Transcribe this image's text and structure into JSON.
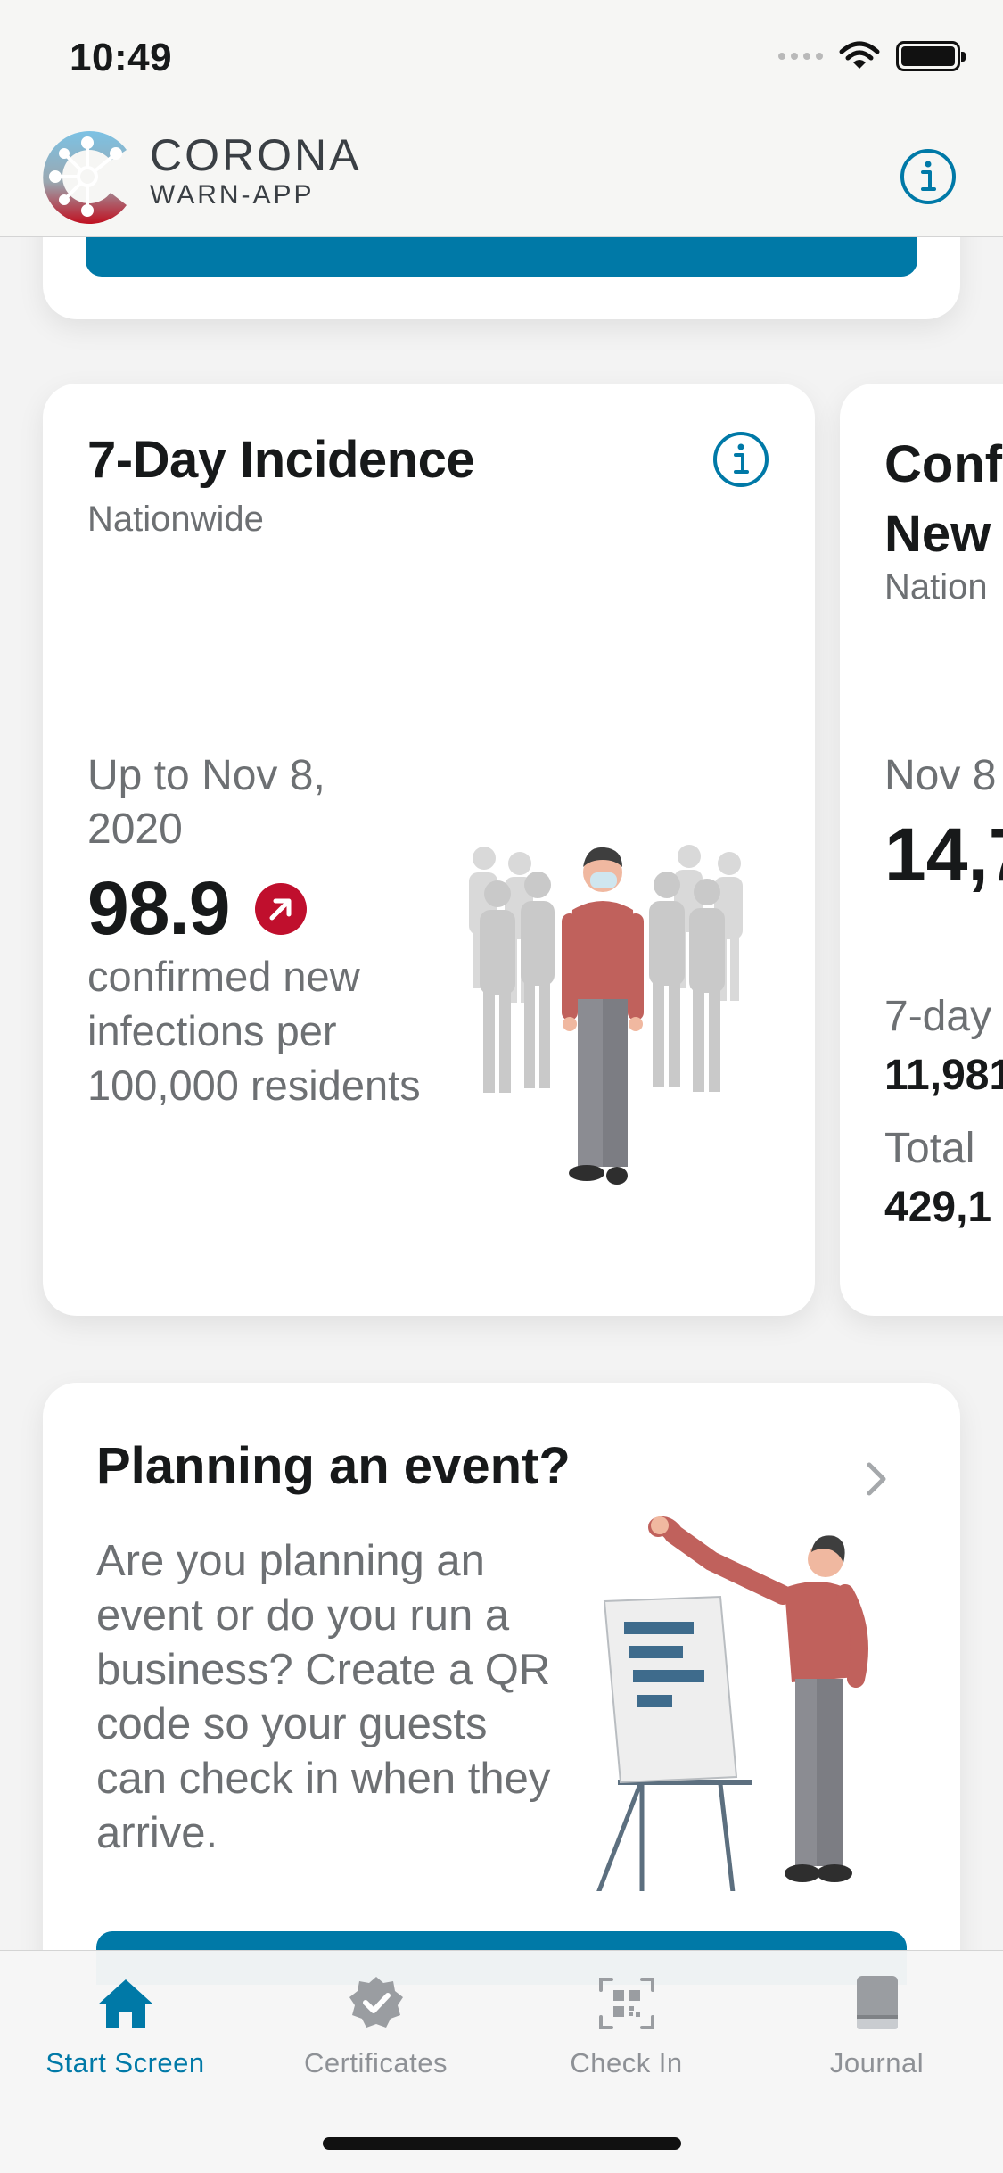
{
  "status_bar": {
    "time": "10:49"
  },
  "header": {
    "brand_name": "CORONA",
    "brand_sub": "WARN-APP",
    "info_icon": "info-icon"
  },
  "incidence_card": {
    "title": "7-Day Incidence",
    "subtitle": "Nationwide",
    "date": "Up to Nov 8, 2020",
    "value": "98.9",
    "trend_icon": "arrow-up-right-icon",
    "description": "confirmed new infections per 100,000 residents"
  },
  "confirmed_card": {
    "title_line1": "Conf",
    "title_line2": "New",
    "subtitle": "Nation",
    "date": "Nov 8",
    "value": "14,7",
    "label1": "7-day",
    "value1": "11,981",
    "label2": "Total",
    "value2": "429,1"
  },
  "event_card": {
    "title": "Planning an event?",
    "text": "Are you planning an event or do you run a business? Create a QR code so your guests can check in when they arrive."
  },
  "tabbar": {
    "tabs": [
      {
        "label": "Start Screen",
        "icon": "home-icon",
        "active": true
      },
      {
        "label": "Certificates",
        "icon": "certificate-icon",
        "active": false
      },
      {
        "label": "Check In",
        "icon": "qr-code-icon",
        "active": false
      },
      {
        "label": "Journal",
        "icon": "journal-icon",
        "active": false
      }
    ]
  },
  "colors": {
    "accent": "#0079a7",
    "trend_red": "#c00f2d",
    "text_secondary": "#6d7073",
    "tab_inactive": "#8e9196"
  }
}
